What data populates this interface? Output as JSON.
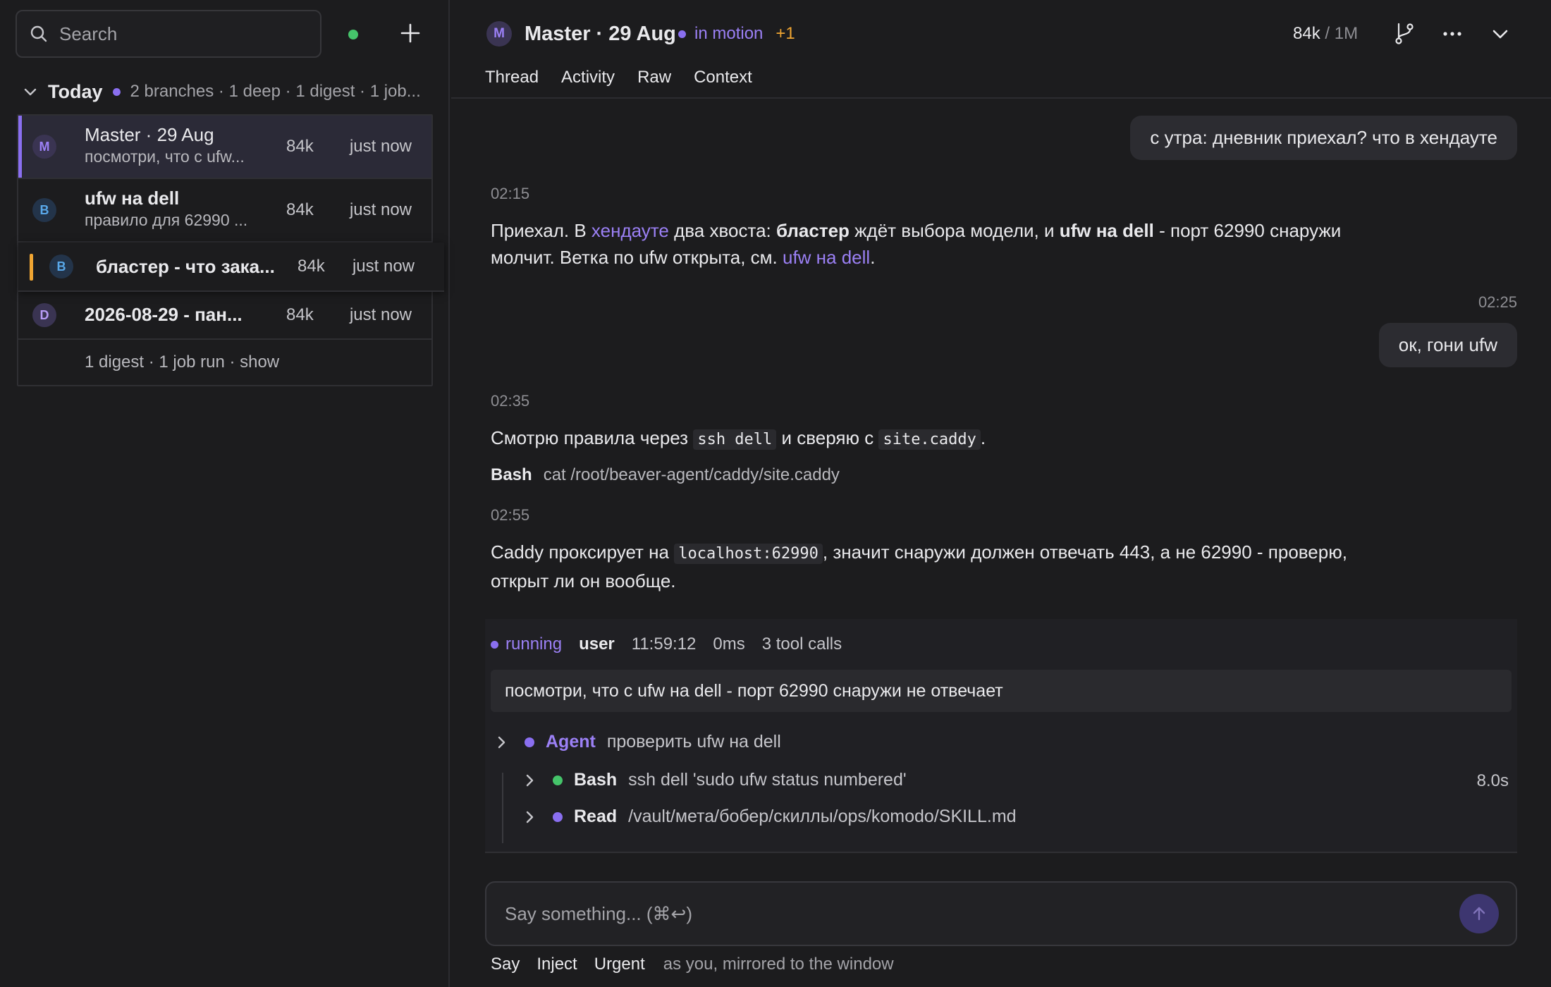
{
  "sidebar": {
    "search_placeholder": "Search",
    "group": {
      "title": "Today",
      "meta": "2 branches · 1 deep · 1 digest · 1 job..."
    },
    "items": [
      {
        "avatar": "M",
        "title": "Master · 29 Aug",
        "subtitle": "посмотри, что с ufw...",
        "tokens": "84k",
        "time": "just now"
      },
      {
        "avatar": "B",
        "title": "ufw на dell",
        "subtitle": "правило для 62990 ...",
        "tokens": "84k",
        "time": "just now"
      },
      {
        "avatar": "B",
        "title": "бластер - что зака...",
        "tokens": "84k",
        "time": "just now"
      },
      {
        "avatar": "D",
        "title": "2026-08-29 - пан...",
        "tokens": "84k",
        "time": "just now"
      }
    ],
    "footer": "1 digest · 1 job run · show"
  },
  "header": {
    "avatar": "M",
    "title": "Master · 29 Aug",
    "state": "in motion",
    "extra": "+1",
    "tokens_used": "84k",
    "tokens_sep": " / ",
    "tokens_limit": "1M",
    "tabs": [
      "Thread",
      "Activity",
      "Raw",
      "Context"
    ]
  },
  "thread": {
    "msg1_user": "с утра: дневник приехал? что в хендауте",
    "ts1": "02:15",
    "msg2": {
      "p1": "Приехал. В ",
      "link1": "хендауте",
      "p2": " два хвоста: ",
      "b1": "бластер",
      "p3": " ждёт выбора модели, и ",
      "b2": "ufw на dell",
      "p4": " - порт 62990 снаружи молчит. Ветка по ufw открыта, см. ",
      "link2": "ufw на dell",
      "p5": "."
    },
    "ts2": "02:25",
    "msg3_user": "ок, гони ufw",
    "ts3": "02:35",
    "msg4": {
      "p1": "Смотрю правила через ",
      "c1": "ssh dell",
      "p2": " и сверяю с ",
      "c2": "site.caddy",
      "p3": "."
    },
    "tool1": {
      "name": "Bash",
      "args": "cat /root/beaver-agent/caddy/site.caddy"
    },
    "ts4": "02:55",
    "msg5": {
      "p1": "Caddy проксирует на ",
      "c1": "localhost:62990",
      "p2": ", значит снаружи должен отвечать 443, а не 62990 - проверю, открыт ли он вообще."
    }
  },
  "run": {
    "status": "running",
    "user": "user",
    "time": "11:59:12",
    "duration": "0ms",
    "calls": "3 tool calls",
    "prompt": "посмотри, что с ufw на dell - порт 62990 снаружи не отвечает",
    "agent": {
      "label": "Agent",
      "desc": "проверить ufw на dell"
    },
    "children": [
      {
        "label": "Bash",
        "desc": "ssh dell 'sudo ufw status numbered'",
        "dur": "8.0s",
        "color": "#45c46a"
      },
      {
        "label": "Read",
        "desc": "/vault/мета/бобер/скиллы/ops/komodo/SKILL.md",
        "color": "#8a6ff0"
      }
    ]
  },
  "composer": {
    "placeholder": "Say something... (⌘↩)",
    "modes": [
      "Say",
      "Inject",
      "Urgent"
    ],
    "hint": "as you, mirrored to the window"
  },
  "colors": {
    "accent": "#8a6ff0",
    "ok": "#45c46a",
    "warn": "#f0a532",
    "bg": "#1c1c1e"
  },
  "icons": [
    "search-icon",
    "plus-icon",
    "chevron-down-icon",
    "branch-icon",
    "more-icon",
    "chevron-right-icon",
    "arrow-up-icon"
  ]
}
